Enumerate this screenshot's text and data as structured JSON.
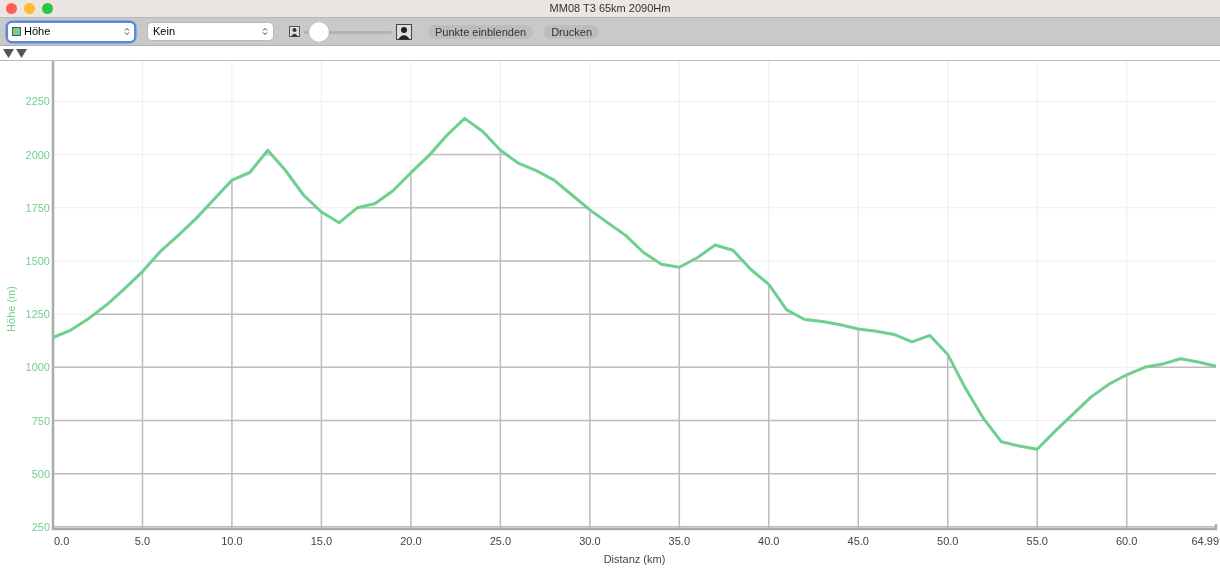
{
  "window": {
    "title": "MM08 T3 65km 2090Hm"
  },
  "toolbar": {
    "series_select": {
      "focused": true
    },
    "compare_select": {
      "value": "Kein"
    },
    "zoom_slider": {
      "level": 0.08
    },
    "buttons": [
      "Punkte einblenden",
      "Drucken"
    ]
  },
  "chart": {
    "chart_data": {
      "type": "line",
      "grid": true,
      "xlabel": "Distanz (km)",
      "ylabel": "Höhe (m)",
      "x": [
        0,
        1,
        2,
        3,
        4,
        5,
        6,
        7,
        8,
        9,
        10,
        11,
        12,
        13,
        14,
        15,
        16,
        17,
        18,
        19,
        20,
        21,
        22,
        23,
        24,
        25,
        26,
        27,
        28,
        29,
        30,
        31,
        32,
        33,
        34,
        35,
        36,
        37,
        38,
        39,
        40,
        41,
        42,
        43,
        44,
        45,
        46,
        47,
        48,
        49,
        50,
        51,
        52,
        53,
        54,
        55,
        56,
        57,
        58,
        59,
        60,
        61,
        62,
        63,
        64,
        64.99
      ],
      "series": [
        {
          "name": "Höhe",
          "color": "#6fcf8f",
          "values": [
            1140,
            1175,
            1230,
            1294,
            1370,
            1450,
            1545,
            1620,
            1700,
            1790,
            1880,
            1916,
            2020,
            1925,
            1810,
            1730,
            1680,
            1750,
            1770,
            1830,
            1915,
            1995,
            2090,
            2170,
            2110,
            2020,
            1960,
            1925,
            1880,
            1810,
            1740,
            1680,
            1620,
            1540,
            1485,
            1470,
            1515,
            1575,
            1550,
            1460,
            1390,
            1270,
            1225,
            1215,
            1200,
            1180,
            1170,
            1155,
            1120,
            1150,
            1060,
            900,
            760,
            650,
            630,
            615,
            700,
            780,
            860,
            920,
            965,
            1000,
            1015,
            1040,
            1025,
            1005
          ]
        }
      ],
      "xlim": [
        0,
        64.99
      ],
      "ylim": [
        240,
        2440
      ],
      "xticks": [
        {
          "value": 0,
          "label": "0.0"
        },
        {
          "value": 5,
          "label": "5.0"
        },
        {
          "value": 10,
          "label": "10.0"
        },
        {
          "value": 15,
          "label": "15.0"
        },
        {
          "value": 20,
          "label": "20.0"
        },
        {
          "value": 25,
          "label": "25.0"
        },
        {
          "value": 30,
          "label": "30.0"
        },
        {
          "value": 35,
          "label": "35.0"
        },
        {
          "value": 40,
          "label": "40.0"
        },
        {
          "value": 45,
          "label": "45.0"
        },
        {
          "value": 50,
          "label": "50.0"
        },
        {
          "value": 55,
          "label": "55.0"
        },
        {
          "value": 60,
          "label": "60.0"
        },
        {
          "value": 64.99,
          "label": "64.99"
        }
      ],
      "yticks": [
        250,
        500,
        750,
        1000,
        1250,
        1500,
        1750,
        2000,
        2250
      ]
    }
  }
}
